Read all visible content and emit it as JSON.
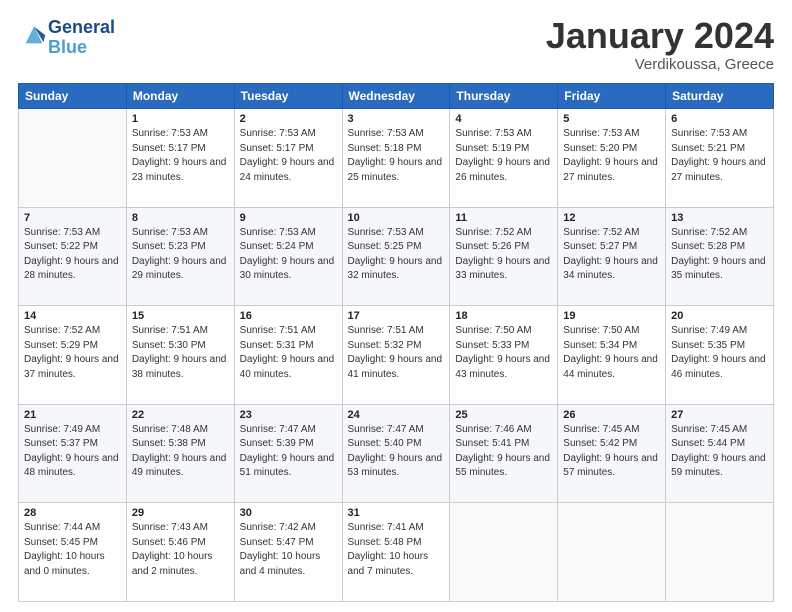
{
  "header": {
    "logo_line1": "General",
    "logo_line2": "Blue",
    "month": "January 2024",
    "location": "Verdikoussa, Greece"
  },
  "days_of_week": [
    "Sunday",
    "Monday",
    "Tuesday",
    "Wednesday",
    "Thursday",
    "Friday",
    "Saturday"
  ],
  "weeks": [
    [
      {
        "num": "",
        "info": ""
      },
      {
        "num": "1",
        "info": "Sunrise: 7:53 AM\nSunset: 5:17 PM\nDaylight: 9 hours\nand 23 minutes."
      },
      {
        "num": "2",
        "info": "Sunrise: 7:53 AM\nSunset: 5:17 PM\nDaylight: 9 hours\nand 24 minutes."
      },
      {
        "num": "3",
        "info": "Sunrise: 7:53 AM\nSunset: 5:18 PM\nDaylight: 9 hours\nand 25 minutes."
      },
      {
        "num": "4",
        "info": "Sunrise: 7:53 AM\nSunset: 5:19 PM\nDaylight: 9 hours\nand 26 minutes."
      },
      {
        "num": "5",
        "info": "Sunrise: 7:53 AM\nSunset: 5:20 PM\nDaylight: 9 hours\nand 27 minutes."
      },
      {
        "num": "6",
        "info": "Sunrise: 7:53 AM\nSunset: 5:21 PM\nDaylight: 9 hours\nand 27 minutes."
      }
    ],
    [
      {
        "num": "7",
        "info": "Sunrise: 7:53 AM\nSunset: 5:22 PM\nDaylight: 9 hours\nand 28 minutes."
      },
      {
        "num": "8",
        "info": "Sunrise: 7:53 AM\nSunset: 5:23 PM\nDaylight: 9 hours\nand 29 minutes."
      },
      {
        "num": "9",
        "info": "Sunrise: 7:53 AM\nSunset: 5:24 PM\nDaylight: 9 hours\nand 30 minutes."
      },
      {
        "num": "10",
        "info": "Sunrise: 7:53 AM\nSunset: 5:25 PM\nDaylight: 9 hours\nand 32 minutes."
      },
      {
        "num": "11",
        "info": "Sunrise: 7:52 AM\nSunset: 5:26 PM\nDaylight: 9 hours\nand 33 minutes."
      },
      {
        "num": "12",
        "info": "Sunrise: 7:52 AM\nSunset: 5:27 PM\nDaylight: 9 hours\nand 34 minutes."
      },
      {
        "num": "13",
        "info": "Sunrise: 7:52 AM\nSunset: 5:28 PM\nDaylight: 9 hours\nand 35 minutes."
      }
    ],
    [
      {
        "num": "14",
        "info": "Sunrise: 7:52 AM\nSunset: 5:29 PM\nDaylight: 9 hours\nand 37 minutes."
      },
      {
        "num": "15",
        "info": "Sunrise: 7:51 AM\nSunset: 5:30 PM\nDaylight: 9 hours\nand 38 minutes."
      },
      {
        "num": "16",
        "info": "Sunrise: 7:51 AM\nSunset: 5:31 PM\nDaylight: 9 hours\nand 40 minutes."
      },
      {
        "num": "17",
        "info": "Sunrise: 7:51 AM\nSunset: 5:32 PM\nDaylight: 9 hours\nand 41 minutes."
      },
      {
        "num": "18",
        "info": "Sunrise: 7:50 AM\nSunset: 5:33 PM\nDaylight: 9 hours\nand 43 minutes."
      },
      {
        "num": "19",
        "info": "Sunrise: 7:50 AM\nSunset: 5:34 PM\nDaylight: 9 hours\nand 44 minutes."
      },
      {
        "num": "20",
        "info": "Sunrise: 7:49 AM\nSunset: 5:35 PM\nDaylight: 9 hours\nand 46 minutes."
      }
    ],
    [
      {
        "num": "21",
        "info": "Sunrise: 7:49 AM\nSunset: 5:37 PM\nDaylight: 9 hours\nand 48 minutes."
      },
      {
        "num": "22",
        "info": "Sunrise: 7:48 AM\nSunset: 5:38 PM\nDaylight: 9 hours\nand 49 minutes."
      },
      {
        "num": "23",
        "info": "Sunrise: 7:47 AM\nSunset: 5:39 PM\nDaylight: 9 hours\nand 51 minutes."
      },
      {
        "num": "24",
        "info": "Sunrise: 7:47 AM\nSunset: 5:40 PM\nDaylight: 9 hours\nand 53 minutes."
      },
      {
        "num": "25",
        "info": "Sunrise: 7:46 AM\nSunset: 5:41 PM\nDaylight: 9 hours\nand 55 minutes."
      },
      {
        "num": "26",
        "info": "Sunrise: 7:45 AM\nSunset: 5:42 PM\nDaylight: 9 hours\nand 57 minutes."
      },
      {
        "num": "27",
        "info": "Sunrise: 7:45 AM\nSunset: 5:44 PM\nDaylight: 9 hours\nand 59 minutes."
      }
    ],
    [
      {
        "num": "28",
        "info": "Sunrise: 7:44 AM\nSunset: 5:45 PM\nDaylight: 10 hours\nand 0 minutes."
      },
      {
        "num": "29",
        "info": "Sunrise: 7:43 AM\nSunset: 5:46 PM\nDaylight: 10 hours\nand 2 minutes."
      },
      {
        "num": "30",
        "info": "Sunrise: 7:42 AM\nSunset: 5:47 PM\nDaylight: 10 hours\nand 4 minutes."
      },
      {
        "num": "31",
        "info": "Sunrise: 7:41 AM\nSunset: 5:48 PM\nDaylight: 10 hours\nand 7 minutes."
      },
      {
        "num": "",
        "info": ""
      },
      {
        "num": "",
        "info": ""
      },
      {
        "num": "",
        "info": ""
      }
    ]
  ]
}
